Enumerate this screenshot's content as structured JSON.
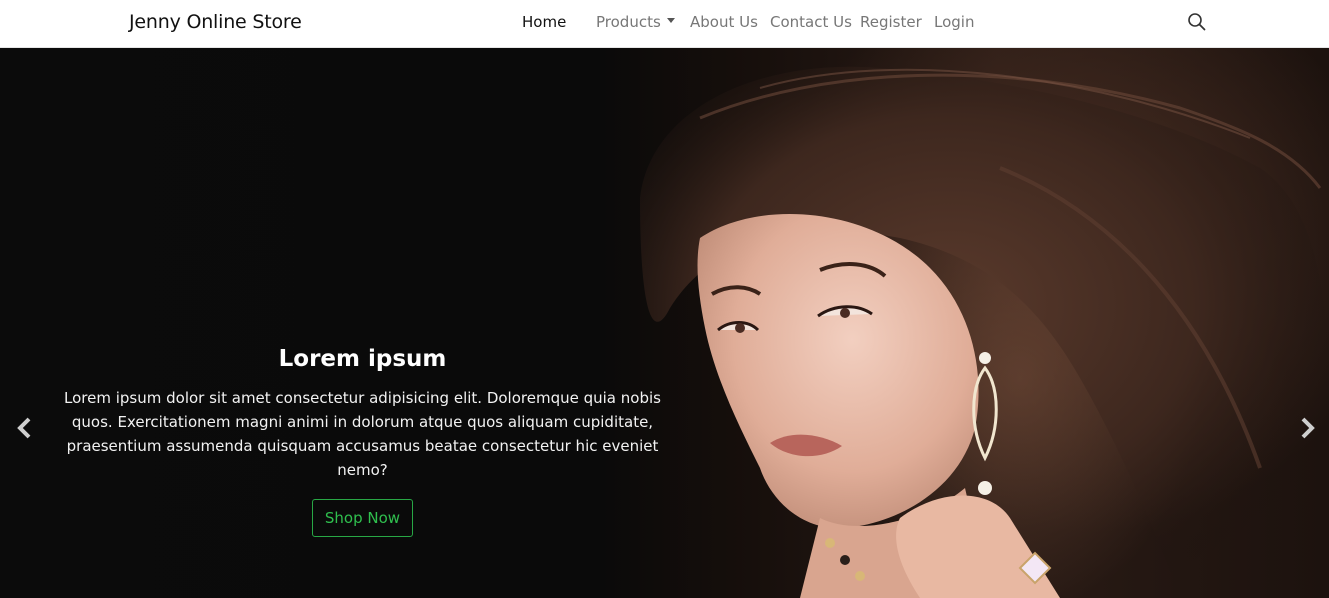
{
  "navbar": {
    "brand": "Jenny Online Store",
    "items": [
      {
        "label": "Home"
      },
      {
        "label": "Products"
      },
      {
        "label": "About Us"
      },
      {
        "label": "Contact Us"
      },
      {
        "label": "Register"
      },
      {
        "label": "Login"
      }
    ],
    "search_icon": "search-icon"
  },
  "carousel": {
    "caption": {
      "title": "Lorem ipsum",
      "text": "Lorem ipsum dolor sit amet consectetur adipisicing elit. Doloremque quia nobis quos. Exercitationem magni animi in dolorum atque quos aliquam cupiditate, praesentium assumenda quisquam accusamus beatae consectetur hic eveniet nemo?",
      "button_label": "Shop Now"
    },
    "prev_icon": "chevron-left-icon",
    "next_icon": "chevron-right-icon"
  },
  "colors": {
    "button_border": "#28a745",
    "button_text": "#2fbf4e",
    "nav_text": "#777777",
    "nav_active": "#111111"
  }
}
